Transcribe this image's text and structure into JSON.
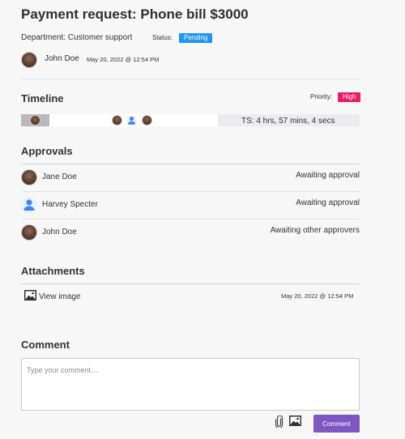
{
  "header": {
    "title": "Payment request: Phone bill $3000",
    "department": "Department: Customer support",
    "status_label": "Status:",
    "status_value": "Pending",
    "status_color": "#2196f3"
  },
  "requester": {
    "name": "John Doe",
    "date": "May 20, 2022 @ 12:54 PM"
  },
  "timeline": {
    "title": "Timeline",
    "priority_label": "Priority:",
    "priority_value": "High",
    "priority_color": "#e91e63",
    "ts": "TS: 4 hrs, 57 mins, 4 secs"
  },
  "approvals": {
    "title": "Approvals",
    "items": [
      {
        "name": "Jane Doe",
        "status": "Awaiting approval",
        "avatar": "photo"
      },
      {
        "name": "Harvey Specter",
        "status": "Awaiting approval",
        "avatar": "person-icon"
      },
      {
        "name": "John Doe",
        "status": "Awaiting other approvers",
        "avatar": "photo"
      }
    ]
  },
  "attachments": {
    "title": "Attachments",
    "items": [
      {
        "label": "View  image",
        "date": "May 20, 2022 @ 12:54 PM",
        "icon": "image-icon"
      }
    ]
  },
  "comment": {
    "title": "Comment",
    "placeholder": "Type your comment....",
    "submit_label": "Comment",
    "submit_color": "#7e57c2",
    "attach_icon": "paperclip-icon",
    "image_icon": "image-icon"
  }
}
